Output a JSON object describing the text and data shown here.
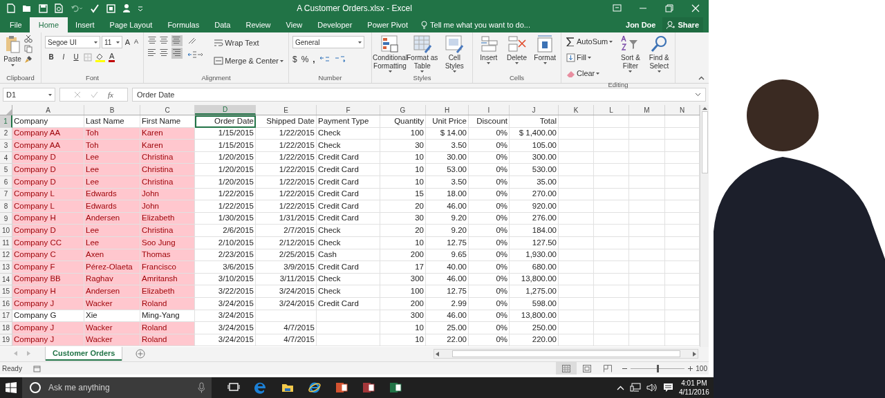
{
  "window": {
    "title": "A Customer Orders.xlsx - Excel"
  },
  "ribbon_tabs": [
    {
      "label": "File",
      "selected": false
    },
    {
      "label": "Home",
      "selected": true
    },
    {
      "label": "Insert",
      "selected": false
    },
    {
      "label": "Page Layout",
      "selected": false
    },
    {
      "label": "Formulas",
      "selected": false
    },
    {
      "label": "Data",
      "selected": false
    },
    {
      "label": "Review",
      "selected": false
    },
    {
      "label": "View",
      "selected": false
    },
    {
      "label": "Developer",
      "selected": false
    },
    {
      "label": "Power Pivot",
      "selected": false
    }
  ],
  "tell_me": {
    "placeholder": "Tell me what you want to do..."
  },
  "user": "Jon Doe",
  "share": "Share",
  "ribbon_groups": [
    {
      "kind": "clipboard",
      "label": "Clipboard",
      "paste": "Paste"
    },
    {
      "kind": "font",
      "label": "Font",
      "font_name": "Segoe UI",
      "font_size": "11",
      "grow": "A",
      "shrink": "A",
      "bold": "B",
      "italic": "I",
      "underline": "U",
      "font_color": "A"
    },
    {
      "kind": "alignment",
      "label": "Alignment",
      "wrap": "Wrap Text",
      "merge": "Merge & Center"
    },
    {
      "kind": "number",
      "label": "Number",
      "format": "General",
      "currency": "$",
      "percent": "%",
      "comma": ","
    },
    {
      "kind": "large",
      "label": "Styles",
      "buttons": [
        "Conditional Formatting",
        "Format as Table",
        "Cell Styles"
      ]
    },
    {
      "kind": "large",
      "label": "Cells",
      "buttons": [
        "Insert",
        "Delete",
        "Format"
      ]
    },
    {
      "kind": "editing",
      "label": "Editing",
      "small": [
        "AutoSum",
        "Fill",
        "Clear"
      ],
      "buttons": [
        "Sort & Filter",
        "Find & Select"
      ]
    }
  ],
  "formula_bar": {
    "name_box": "D1",
    "fx": "fx",
    "value": "Order Date"
  },
  "columns": [
    {
      "letter": "A",
      "kind": "text",
      "selected": false
    },
    {
      "letter": "B",
      "kind": "text",
      "selected": false
    },
    {
      "letter": "C",
      "kind": "text",
      "selected": false
    },
    {
      "letter": "D",
      "kind": "number",
      "selected": true
    },
    {
      "letter": "E",
      "kind": "number",
      "selected": false
    },
    {
      "letter": "F",
      "kind": "text",
      "selected": false
    },
    {
      "letter": "G",
      "kind": "number",
      "selected": false
    },
    {
      "letter": "H",
      "kind": "number",
      "selected": false
    },
    {
      "letter": "I",
      "kind": "number",
      "selected": false
    },
    {
      "letter": "J",
      "kind": "number",
      "selected": false
    },
    {
      "letter": "K",
      "kind": "text",
      "selected": false
    },
    {
      "letter": "L",
      "kind": "text",
      "selected": false
    },
    {
      "letter": "M",
      "kind": "text",
      "selected": false
    },
    {
      "letter": "N",
      "kind": "text",
      "selected": false
    }
  ],
  "rows": [
    {
      "number": "1",
      "selected": true,
      "highlighted": false,
      "cells": [
        "Company",
        "Last Name",
        "First Name",
        "Order Date",
        "Shipped Date",
        "Payment Type",
        "Quantity",
        "Unit Price",
        "Discount",
        "Total"
      ]
    },
    {
      "number": "2",
      "selected": false,
      "highlighted": true,
      "cells": [
        "Company AA",
        "Toh",
        "Karen",
        "1/15/2015",
        "1/22/2015",
        "Check",
        "100",
        "$ 14.00",
        "0%",
        "$ 1,400.00"
      ]
    },
    {
      "number": "3",
      "selected": false,
      "highlighted": true,
      "cells": [
        "Company AA",
        "Toh",
        "Karen",
        "1/15/2015",
        "1/22/2015",
        "Check",
        "30",
        "3.50",
        "0%",
        "105.00"
      ]
    },
    {
      "number": "4",
      "selected": false,
      "highlighted": true,
      "cells": [
        "Company D",
        "Lee",
        "Christina",
        "1/20/2015",
        "1/22/2015",
        "Credit Card",
        "10",
        "30.00",
        "0%",
        "300.00"
      ]
    },
    {
      "number": "5",
      "selected": false,
      "highlighted": true,
      "cells": [
        "Company D",
        "Lee",
        "Christina",
        "1/20/2015",
        "1/22/2015",
        "Credit Card",
        "10",
        "53.00",
        "0%",
        "530.00"
      ]
    },
    {
      "number": "6",
      "selected": false,
      "highlighted": true,
      "cells": [
        "Company D",
        "Lee",
        "Christina",
        "1/20/2015",
        "1/22/2015",
        "Credit Card",
        "10",
        "3.50",
        "0%",
        "35.00"
      ]
    },
    {
      "number": "7",
      "selected": false,
      "highlighted": true,
      "cells": [
        "Company L",
        "Edwards",
        "John",
        "1/22/2015",
        "1/22/2015",
        "Credit Card",
        "15",
        "18.00",
        "0%",
        "270.00"
      ]
    },
    {
      "number": "8",
      "selected": false,
      "highlighted": true,
      "cells": [
        "Company L",
        "Edwards",
        "John",
        "1/22/2015",
        "1/22/2015",
        "Credit Card",
        "20",
        "46.00",
        "0%",
        "920.00"
      ]
    },
    {
      "number": "9",
      "selected": false,
      "highlighted": true,
      "cells": [
        "Company H",
        "Andersen",
        "Elizabeth",
        "1/30/2015",
        "1/31/2015",
        "Credit Card",
        "30",
        "9.20",
        "0%",
        "276.00"
      ]
    },
    {
      "number": "10",
      "selected": false,
      "highlighted": true,
      "cells": [
        "Company D",
        "Lee",
        "Christina",
        "2/6/2015",
        "2/7/2015",
        "Check",
        "20",
        "9.20",
        "0%",
        "184.00"
      ]
    },
    {
      "number": "11",
      "selected": false,
      "highlighted": true,
      "cells": [
        "Company CC",
        "Lee",
        "Soo Jung",
        "2/10/2015",
        "2/12/2015",
        "Check",
        "10",
        "12.75",
        "0%",
        "127.50"
      ]
    },
    {
      "number": "12",
      "selected": false,
      "highlighted": true,
      "cells": [
        "Company C",
        "Axen",
        "Thomas",
        "2/23/2015",
        "2/25/2015",
        "Cash",
        "200",
        "9.65",
        "0%",
        "1,930.00"
      ]
    },
    {
      "number": "13",
      "selected": false,
      "highlighted": true,
      "cells": [
        "Company F",
        "Pérez-Olaeta",
        "Francisco",
        "3/6/2015",
        "3/9/2015",
        "Credit Card",
        "17",
        "40.00",
        "0%",
        "680.00"
      ]
    },
    {
      "number": "14",
      "selected": false,
      "highlighted": true,
      "cells": [
        "Company BB",
        "Raghav",
        "Amritansh",
        "3/10/2015",
        "3/11/2015",
        "Check",
        "300",
        "46.00",
        "0%",
        "13,800.00"
      ]
    },
    {
      "number": "15",
      "selected": false,
      "highlighted": true,
      "cells": [
        "Company H",
        "Andersen",
        "Elizabeth",
        "3/22/2015",
        "3/24/2015",
        "Check",
        "100",
        "12.75",
        "0%",
        "1,275.00"
      ]
    },
    {
      "number": "16",
      "selected": false,
      "highlighted": true,
      "cells": [
        "Company J",
        "Wacker",
        "Roland",
        "3/24/2015",
        "3/24/2015",
        "Credit Card",
        "200",
        "2.99",
        "0%",
        "598.00"
      ]
    },
    {
      "number": "17",
      "selected": false,
      "highlighted": false,
      "cells": [
        "Company G",
        "Xie",
        "Ming-Yang",
        "3/24/2015",
        null,
        null,
        "300",
        "46.00",
        "0%",
        "13,800.00"
      ]
    },
    {
      "number": "18",
      "selected": false,
      "highlighted": true,
      "cells": [
        "Company J",
        "Wacker",
        "Roland",
        "3/24/2015",
        "4/7/2015",
        null,
        "10",
        "25.00",
        "0%",
        "250.00"
      ]
    },
    {
      "number": "19",
      "selected": false,
      "highlighted": true,
      "cells": [
        "Company J",
        "Wacker",
        "Roland",
        "3/24/2015",
        "4/7/2015",
        null,
        "10",
        "22.00",
        "0%",
        "220.00"
      ]
    }
  ],
  "sheet_tabs": [
    {
      "label": "Customer Orders",
      "selected": true
    }
  ],
  "status_bar": {
    "status": "Ready",
    "zoom_slider": {
      "level": 0.5
    },
    "zoom": "100"
  },
  "taskbar": {
    "search": {
      "placeholder": "Ask me anything"
    },
    "time": "4:01 PM",
    "date": "4/11/2016"
  }
}
